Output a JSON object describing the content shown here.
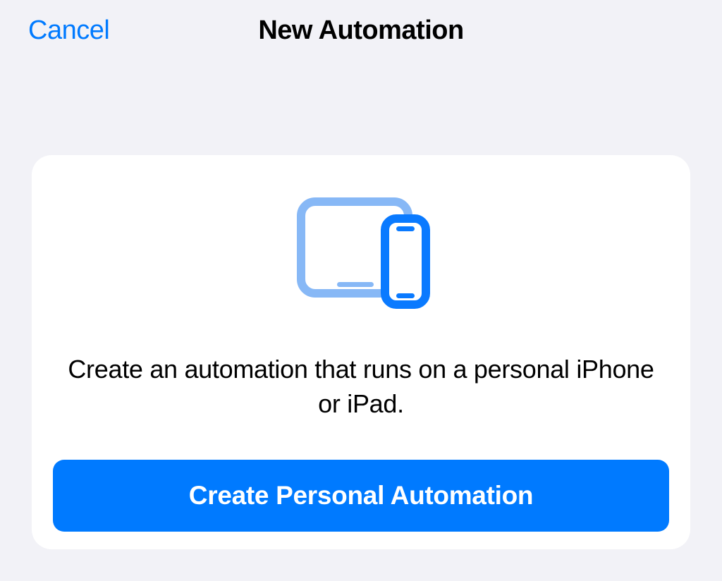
{
  "header": {
    "cancel_label": "Cancel",
    "title": "New Automation"
  },
  "card": {
    "icon_name": "devices-icon",
    "description": "Create an automation that runs on a personal iPhone or iPad.",
    "button_label": "Create Personal Automation"
  },
  "colors": {
    "accent": "#007aff",
    "accent_light": "#87b8f6",
    "background": "#f2f2f7",
    "card_bg": "#ffffff"
  }
}
